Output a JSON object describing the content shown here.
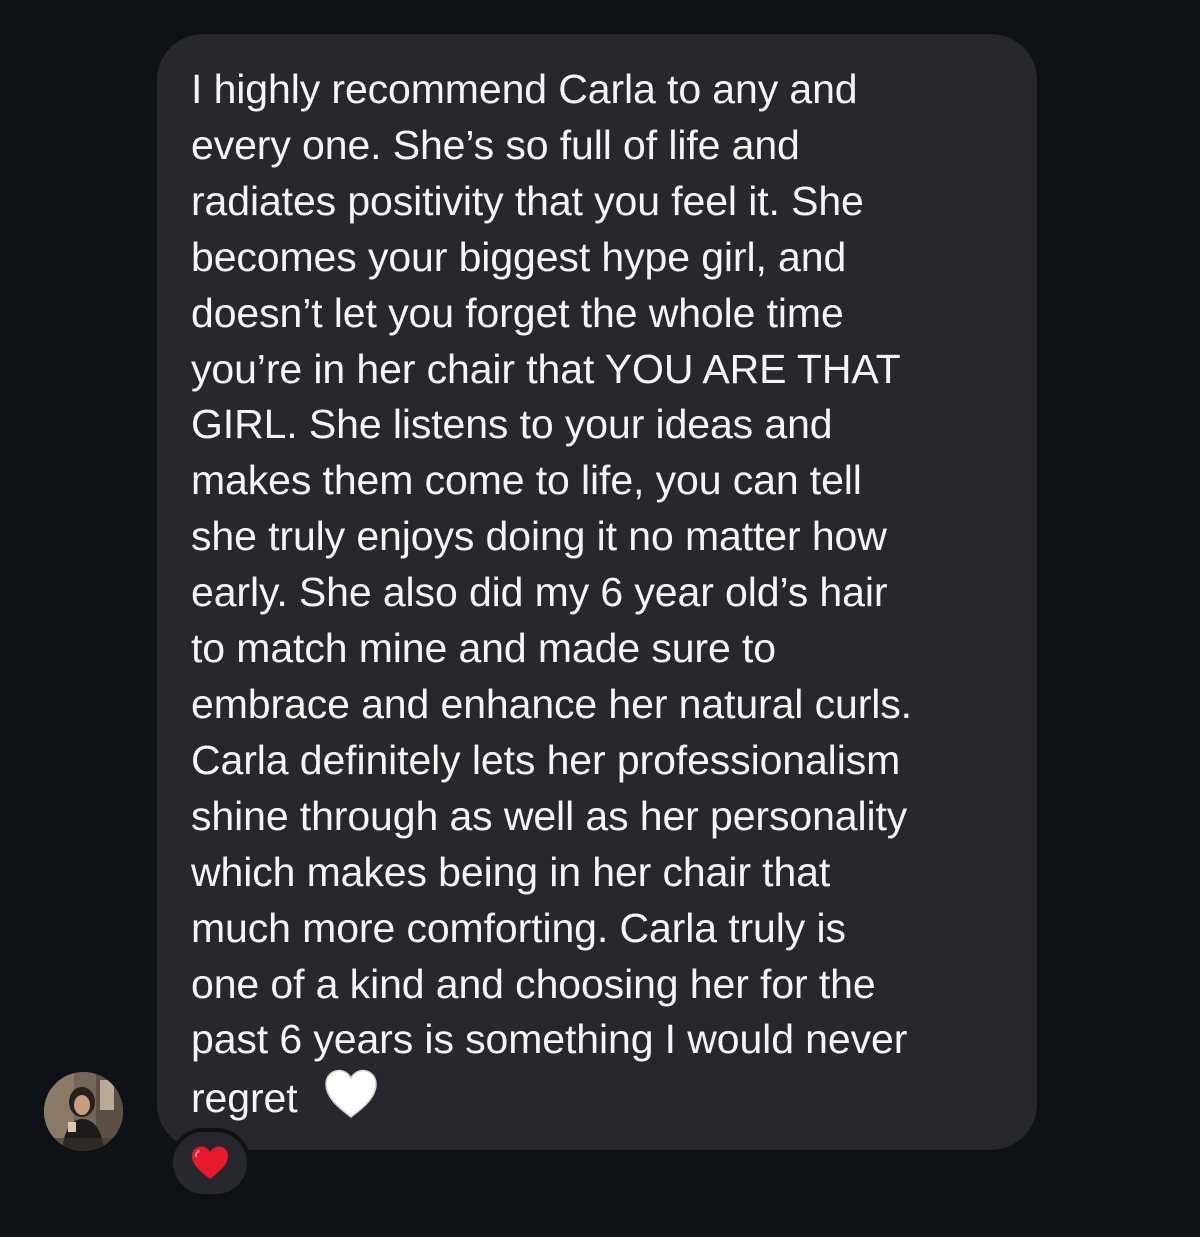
{
  "message": {
    "lines": [
      "I highly recommend Carla to any and",
      "every one. She’s so full of life and",
      "radiates positivity that you feel it. She",
      "becomes your biggest hype girl, and",
      "doesn’t let you forget the whole time",
      "you’re in her chair that YOU ARE THAT",
      "GIRL. She listens to your ideas and",
      "makes them come to life, you can tell",
      "she truly enjoys doing it no matter how",
      "early. She also did my 6 year old’s hair",
      "to match mine and made sure to",
      "embrace and enhance her natural curls.",
      "Carla definitely lets her professionalism",
      "shine through as well as her personality",
      "which makes being in her chair that",
      "much more comforting. Carla truly is",
      "one of a kind and choosing her for the",
      "past 6 years is something I would never",
      "regret"
    ],
    "trailing_emoji": "white-heart-icon"
  },
  "reaction": {
    "emoji": "red-heart-icon"
  },
  "sender": {
    "avatar": "profile-photo"
  },
  "colors": {
    "background": "#0e1116",
    "bubble": "#26282d",
    "text": "#f5f5f5",
    "reaction_heart": "#e8182d",
    "white_heart": "#ffffff"
  }
}
